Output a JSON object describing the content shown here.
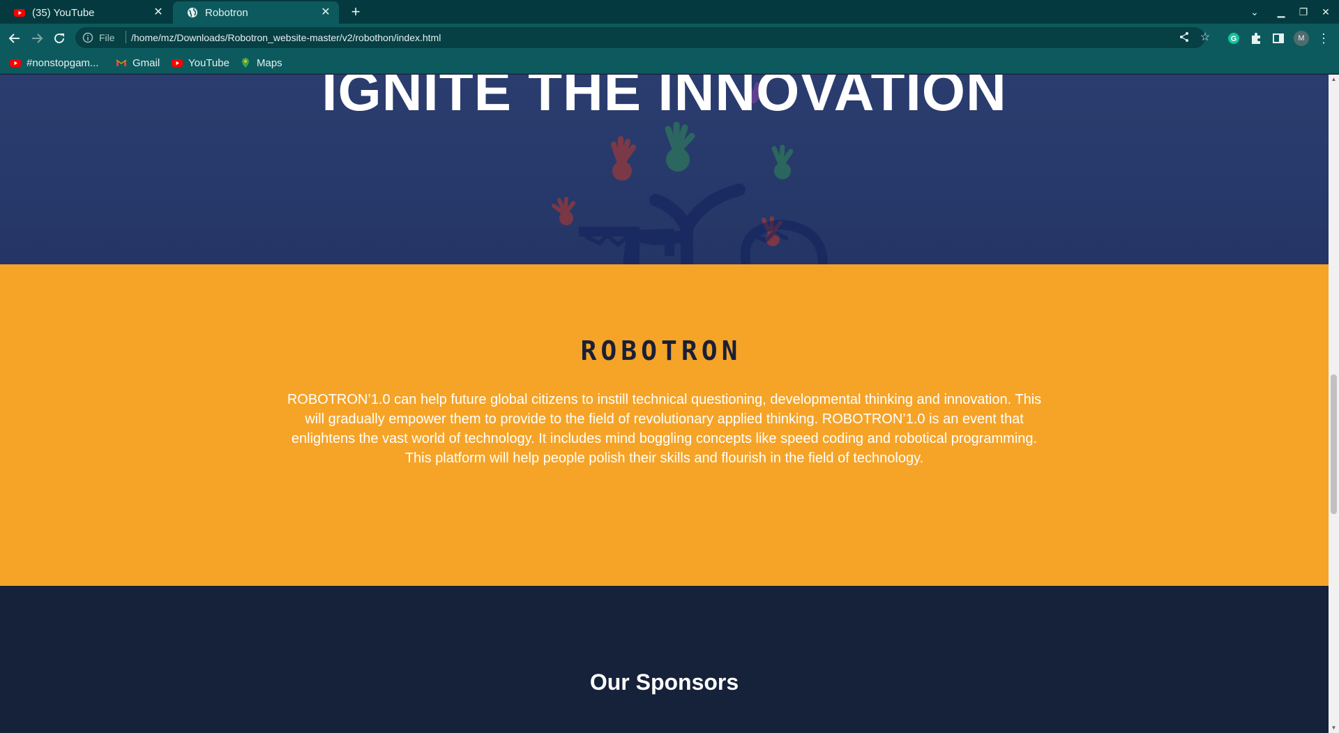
{
  "browser": {
    "tabs": [
      {
        "title": "(35) YouTube",
        "icon": "youtube-icon"
      },
      {
        "title": "Robotron",
        "icon": "globe-icon"
      }
    ],
    "new_tab_symbol": "+",
    "address": {
      "scheme": "File",
      "url": "/home/mz/Downloads/Robotron_website-master/v2/robothon/index.html"
    },
    "bookmarks": [
      {
        "label": "#nonstopgam...",
        "icon": "youtube-icon"
      },
      {
        "label": "Gmail",
        "icon": "gmail-icon"
      },
      {
        "label": "YouTube",
        "icon": "youtube-icon"
      },
      {
        "label": "Maps",
        "icon": "maps-icon"
      }
    ],
    "profile_initial": "M",
    "colors": {
      "frame": "#043a3f",
      "toolbar": "#0d5a5e"
    }
  },
  "page": {
    "hero_title": "IGNITE THE INNOVATION",
    "logo_text": "ROBOTRON",
    "about_text": "ROBOTRON’1.0 can help future global citizens to instill technical questioning, developmental thinking and innovation. This will gradually empower them to provide to the field of revolutionary applied thinking. ROBOTRON’1.0 is an event that enlightens the vast world of technology. It includes mind boggling concepts like speed coding and robotical programming. This platform will help people polish their skills and flourish in the field of technology.",
    "sponsors_title": "Our Sponsors",
    "colors": {
      "hero": "#27396a",
      "about": "#f5a428",
      "sponsors": "#16213a"
    }
  }
}
